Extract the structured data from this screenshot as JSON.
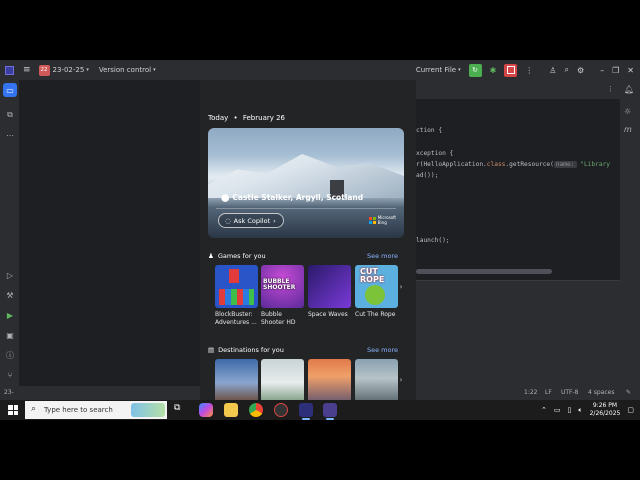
{
  "ide": {
    "project_badge": "22",
    "project_name": "23-02-25",
    "vcs_label": "Version control",
    "run_config": "Current File",
    "code_lines": [
      {
        "text": "ction {"
      },
      {
        "text": "xception {"
      },
      {
        "pre": "r(HelloApplication.",
        "kw": "class",
        "post": ".getResource(",
        "hint": "name:",
        "str": " \"Library"
      },
      {
        "text": "ad());"
      },
      {
        "text": "launch();"
      }
    ],
    "status": {
      "left": "23-",
      "position": "1:22",
      "line_sep": "LF",
      "encoding": "UTF-8",
      "indent": "4 spaces"
    }
  },
  "widgets": {
    "date_today": "Today",
    "date_bullet": "•",
    "date_value": "February 26",
    "hero": {
      "location": "Castle Stalker, Argyll, Scotland",
      "copilot_label": "Ask Copilot",
      "brand_line1": "Microsoft",
      "brand_line2": "Bing"
    },
    "games": {
      "title": "Games for you",
      "see_more": "See more",
      "items": [
        {
          "label": "BlockBuster: Adventures ..."
        },
        {
          "label": "Bubble Shooter HD",
          "art_text": "BUBBLE SHOOTER"
        },
        {
          "label": "Space Waves"
        },
        {
          "label": "Cut The Rope",
          "art_text": "CUT ROPE"
        }
      ]
    },
    "destinations": {
      "title": "Destinations for you",
      "see_more": "See more"
    }
  },
  "taskbar": {
    "search_placeholder": "Type here to search",
    "time": "9:26 PM",
    "date": "2/26/2025"
  }
}
